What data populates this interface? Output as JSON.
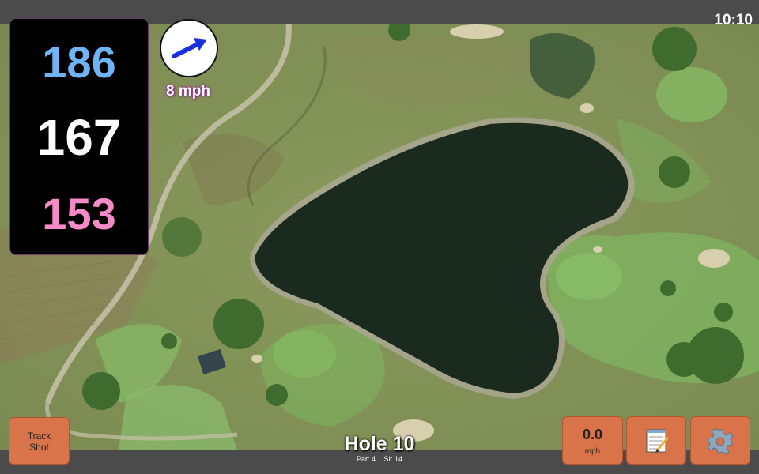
{
  "status": {
    "time": "10:10"
  },
  "distances": {
    "back": {
      "value": "186",
      "color": "#6fb4f5"
    },
    "middle": {
      "value": "167",
      "color": "#ffffff"
    },
    "front": {
      "value": "153",
      "color": "#f58ac8"
    }
  },
  "wind": {
    "speed_label": "8 mph",
    "direction_icon": "arrow-icon",
    "arrow_color": "#1a2fe0"
  },
  "buttons": {
    "track_shot": "Track Shot",
    "speed_value": "0.0",
    "speed_unit": "mph",
    "notes_icon": "notepad-icon",
    "settings_icon": "gear-icon"
  },
  "hole": {
    "title": "Hole 10",
    "par": "Par: 4",
    "si": "SI: 14"
  },
  "colors": {
    "accent_button": "#d9744a",
    "water": "#1b2a1e",
    "fairway": "#7aa35a"
  }
}
